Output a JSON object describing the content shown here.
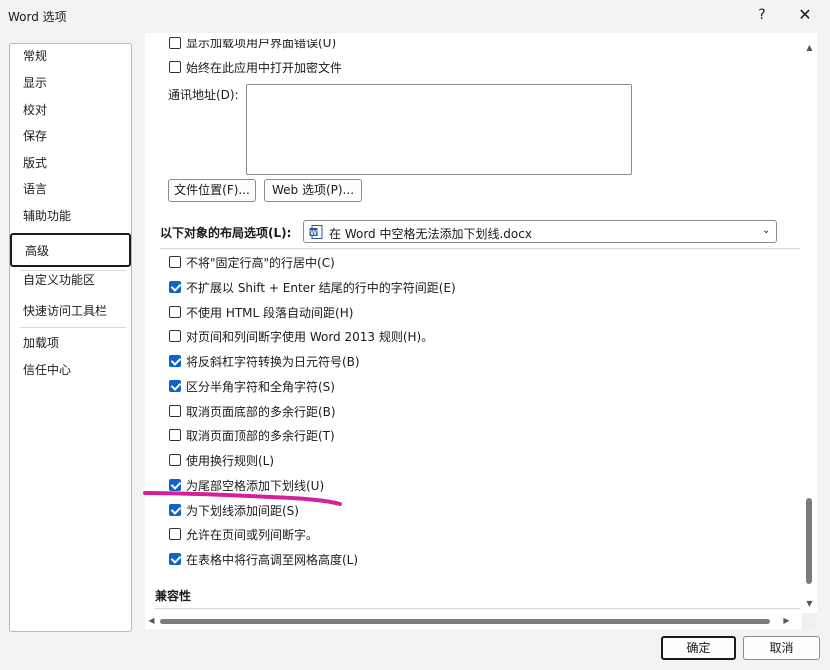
{
  "window": {
    "title": "Word 选项",
    "help": "?",
    "close": "✕"
  },
  "sidebar": {
    "items": [
      "常规",
      "显示",
      "校对",
      "保存",
      "版式",
      "语言",
      "辅助功能",
      "高级",
      "自定义功能区",
      "快速访问工具栏",
      "加载项",
      "信任中心"
    ],
    "active_index": 7
  },
  "content": {
    "partial_top_option": {
      "label": "显示加载项用户界面错误(U)",
      "checked": false
    },
    "option_encrypted": {
      "label": "始终在此应用中打开加密文件",
      "checked": false
    },
    "mailing_address_label": "通讯地址(D):",
    "mailing_address_value": "",
    "file_locations_button": "文件位置(F)...",
    "web_options_button": "Web 选项(P)...",
    "layout_options_label": "以下对象的布局选项(L):",
    "layout_doc_select": "在 Word 中空格无法添加下划线.docx",
    "layout_options": [
      {
        "label": "不将\"固定行高\"的行居中(C)",
        "checked": false
      },
      {
        "label": "不扩展以 Shift + Enter 结尾的行中的字符间距(E)",
        "checked": true
      },
      {
        "label": "不使用 HTML 段落自动间距(H)",
        "checked": false
      },
      {
        "label": "对页间和列间断字使用 Word 2013 规则(H)。",
        "checked": false
      },
      {
        "label": "将反斜杠字符转换为日元符号(B)",
        "checked": true
      },
      {
        "label": "区分半角字符和全角字符(S)",
        "checked": true
      },
      {
        "label": "取消页面底部的多余行距(B)",
        "checked": false
      },
      {
        "label": "取消页面顶部的多余行距(T)",
        "checked": false
      },
      {
        "label": "使用换行规则(L)",
        "checked": false
      },
      {
        "label": "为尾部空格添加下划线(U)",
        "checked": true
      },
      {
        "label": "为下划线添加间距(S)",
        "checked": true
      },
      {
        "label": "允许在页间或列间断字。",
        "checked": false
      },
      {
        "label": "在表格中将行高调至网格高度(L)",
        "checked": true
      }
    ],
    "compat_heading": "兼容性"
  },
  "footer": {
    "ok": "确定",
    "cancel": "取消"
  },
  "colors": {
    "checkbox_accent": "#0f62c8",
    "highlight_stroke": "#d61f9b"
  }
}
